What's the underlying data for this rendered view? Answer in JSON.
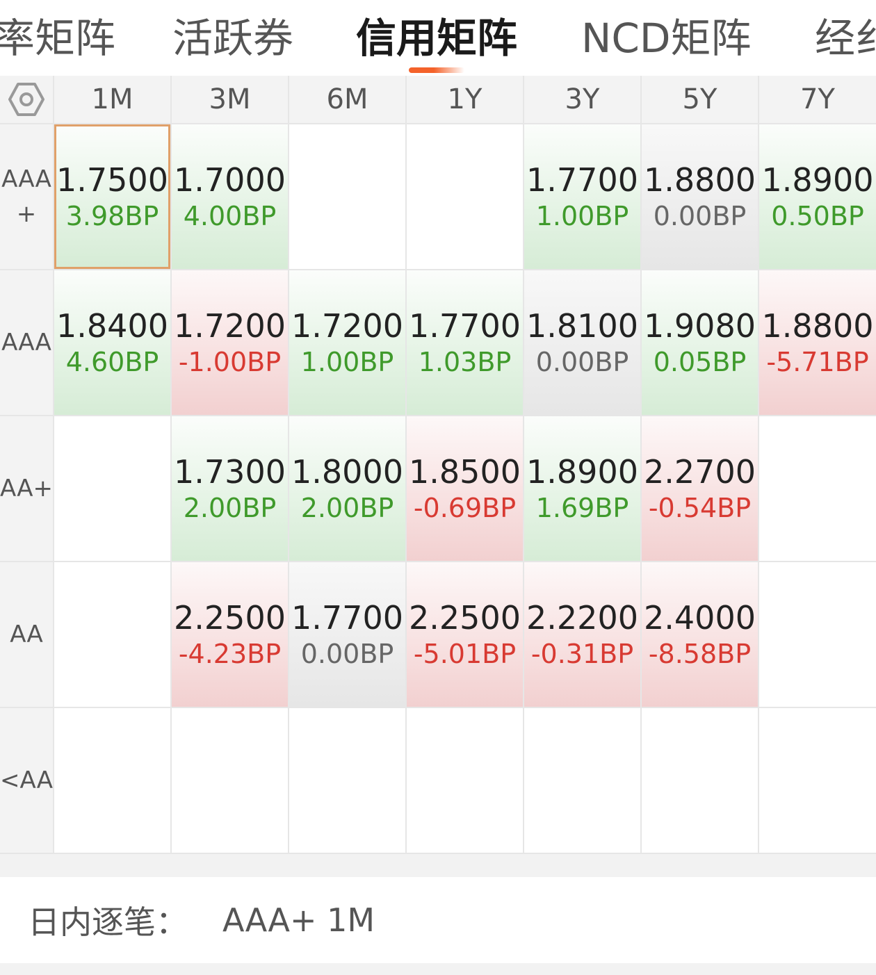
{
  "tabs": [
    {
      "label": "率矩阵",
      "active": false
    },
    {
      "label": "活跃券",
      "active": false
    },
    {
      "label": "信用矩阵",
      "active": true
    },
    {
      "label": "NCD矩阵",
      "active": false
    },
    {
      "label": "经纟",
      "active": false
    }
  ],
  "settings_icon": "hexagon-gear-icon",
  "columns": [
    "1M",
    "3M",
    "6M",
    "1Y",
    "3Y",
    "5Y",
    "7Y"
  ],
  "rows": [
    {
      "label": "AAA+",
      "cells": [
        {
          "value": "1.7500",
          "change": "3.98BP",
          "trend": "pos",
          "selected": true
        },
        {
          "value": "1.7000",
          "change": "4.00BP",
          "trend": "pos"
        },
        null,
        null,
        {
          "value": "1.7700",
          "change": "1.00BP",
          "trend": "pos"
        },
        {
          "value": "1.8800",
          "change": "0.00BP",
          "trend": "flat"
        },
        {
          "value": "1.8900",
          "change": "0.50BP",
          "trend": "pos"
        }
      ]
    },
    {
      "label": "AAA",
      "cells": [
        {
          "value": "1.8400",
          "change": "4.60BP",
          "trend": "pos"
        },
        {
          "value": "1.7200",
          "change": "-1.00BP",
          "trend": "neg"
        },
        {
          "value": "1.7200",
          "change": "1.00BP",
          "trend": "pos"
        },
        {
          "value": "1.7700",
          "change": "1.03BP",
          "trend": "pos"
        },
        {
          "value": "1.8100",
          "change": "0.00BP",
          "trend": "flat"
        },
        {
          "value": "1.9080",
          "change": "0.05BP",
          "trend": "pos"
        },
        {
          "value": "1.8800",
          "change": "-5.71BP",
          "trend": "neg"
        }
      ]
    },
    {
      "label": "AA+",
      "cells": [
        null,
        {
          "value": "1.7300",
          "change": "2.00BP",
          "trend": "pos"
        },
        {
          "value": "1.8000",
          "change": "2.00BP",
          "trend": "pos"
        },
        {
          "value": "1.8500",
          "change": "-0.69BP",
          "trend": "neg"
        },
        {
          "value": "1.8900",
          "change": "1.69BP",
          "trend": "pos"
        },
        {
          "value": "2.2700",
          "change": "-0.54BP",
          "trend": "neg"
        },
        null
      ]
    },
    {
      "label": "AA",
      "cells": [
        null,
        {
          "value": "2.2500",
          "change": "-4.23BP",
          "trend": "neg"
        },
        {
          "value": "1.7700",
          "change": "0.00BP",
          "trend": "flat"
        },
        {
          "value": "2.2500",
          "change": "-5.01BP",
          "trend": "neg"
        },
        {
          "value": "2.2200",
          "change": "-0.31BP",
          "trend": "neg"
        },
        {
          "value": "2.4000",
          "change": "-8.58BP",
          "trend": "neg"
        },
        null
      ]
    },
    {
      "label": "<AA",
      "cells": [
        null,
        null,
        null,
        null,
        null,
        null,
        null
      ]
    }
  ],
  "footer": {
    "label": "日内逐笔：",
    "selection": "AAA+ 1M"
  },
  "colors": {
    "accent": "#f4622a",
    "positive": "#3f9a2b",
    "negative": "#d83a32",
    "selected_border": "#e0a069"
  }
}
